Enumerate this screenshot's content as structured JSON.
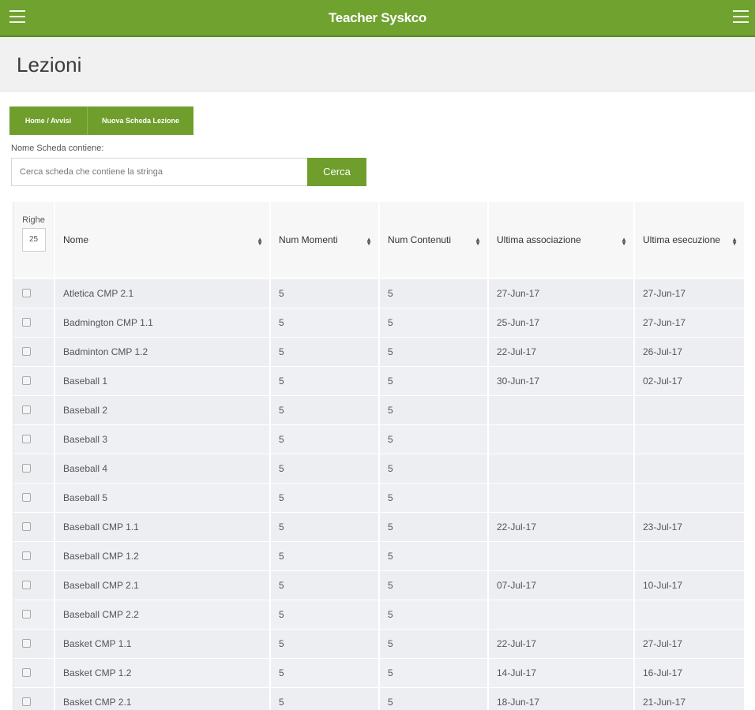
{
  "app": {
    "title": "Teacher Syskco"
  },
  "page": {
    "title": "Lezioni"
  },
  "nav": {
    "home_label": "Home / Avvisi",
    "new_label": "Nuova Scheda Lezione"
  },
  "search": {
    "label": "Nome Scheda contiene:",
    "placeholder": "Cerca scheda che contiene la stringa",
    "value": "",
    "button_label": "Cerca"
  },
  "table": {
    "rows_label": "Righe",
    "rows_value": "25",
    "columns": [
      "Nome",
      "Num Momenti",
      "Num Contenuti",
      "Ultima associazione",
      "Ultima esecuzione"
    ],
    "rows": [
      {
        "nome": "Atletica CMP 2.1",
        "momenti": "5",
        "contenuti": "5",
        "associazione": "27-Jun-17",
        "esecuzione": "27-Jun-17"
      },
      {
        "nome": "Badmington CMP 1.1",
        "momenti": "5",
        "contenuti": "5",
        "associazione": "25-Jun-17",
        "esecuzione": "27-Jun-17"
      },
      {
        "nome": "Badminton CMP 1.2",
        "momenti": "5",
        "contenuti": "5",
        "associazione": "22-Jul-17",
        "esecuzione": "26-Jul-17"
      },
      {
        "nome": "Baseball 1",
        "momenti": "5",
        "contenuti": "5",
        "associazione": "30-Jun-17",
        "esecuzione": "02-Jul-17"
      },
      {
        "nome": "Baseball 2",
        "momenti": "5",
        "contenuti": "5",
        "associazione": "",
        "esecuzione": ""
      },
      {
        "nome": "Baseball 3",
        "momenti": "5",
        "contenuti": "5",
        "associazione": "",
        "esecuzione": ""
      },
      {
        "nome": "Baseball 4",
        "momenti": "5",
        "contenuti": "5",
        "associazione": "",
        "esecuzione": ""
      },
      {
        "nome": "Baseball 5",
        "momenti": "5",
        "contenuti": "5",
        "associazione": "",
        "esecuzione": ""
      },
      {
        "nome": "Baseball CMP 1.1",
        "momenti": "5",
        "contenuti": "5",
        "associazione": "22-Jul-17",
        "esecuzione": "23-Jul-17"
      },
      {
        "nome": "Baseball CMP 1.2",
        "momenti": "5",
        "contenuti": "5",
        "associazione": "",
        "esecuzione": ""
      },
      {
        "nome": "Baseball CMP 2.1",
        "momenti": "5",
        "contenuti": "5",
        "associazione": "07-Jul-17",
        "esecuzione": "10-Jul-17"
      },
      {
        "nome": "Baseball CMP 2.2",
        "momenti": "5",
        "contenuti": "5",
        "associazione": "",
        "esecuzione": ""
      },
      {
        "nome": "Basket CMP 1.1",
        "momenti": "5",
        "contenuti": "5",
        "associazione": "22-Jul-17",
        "esecuzione": "27-Jul-17"
      },
      {
        "nome": "Basket CMP 1.2",
        "momenti": "5",
        "contenuti": "5",
        "associazione": "14-Jul-17",
        "esecuzione": "16-Jul-17"
      },
      {
        "nome": "Basket CMP 2.1",
        "momenti": "5",
        "contenuti": "5",
        "associazione": "18-Jun-17",
        "esecuzione": "21-Jun-17"
      }
    ]
  },
  "colors": {
    "brand_green": "#6fa22e",
    "button_green": "#6f9e2d",
    "row_bg": "#eceef2"
  }
}
